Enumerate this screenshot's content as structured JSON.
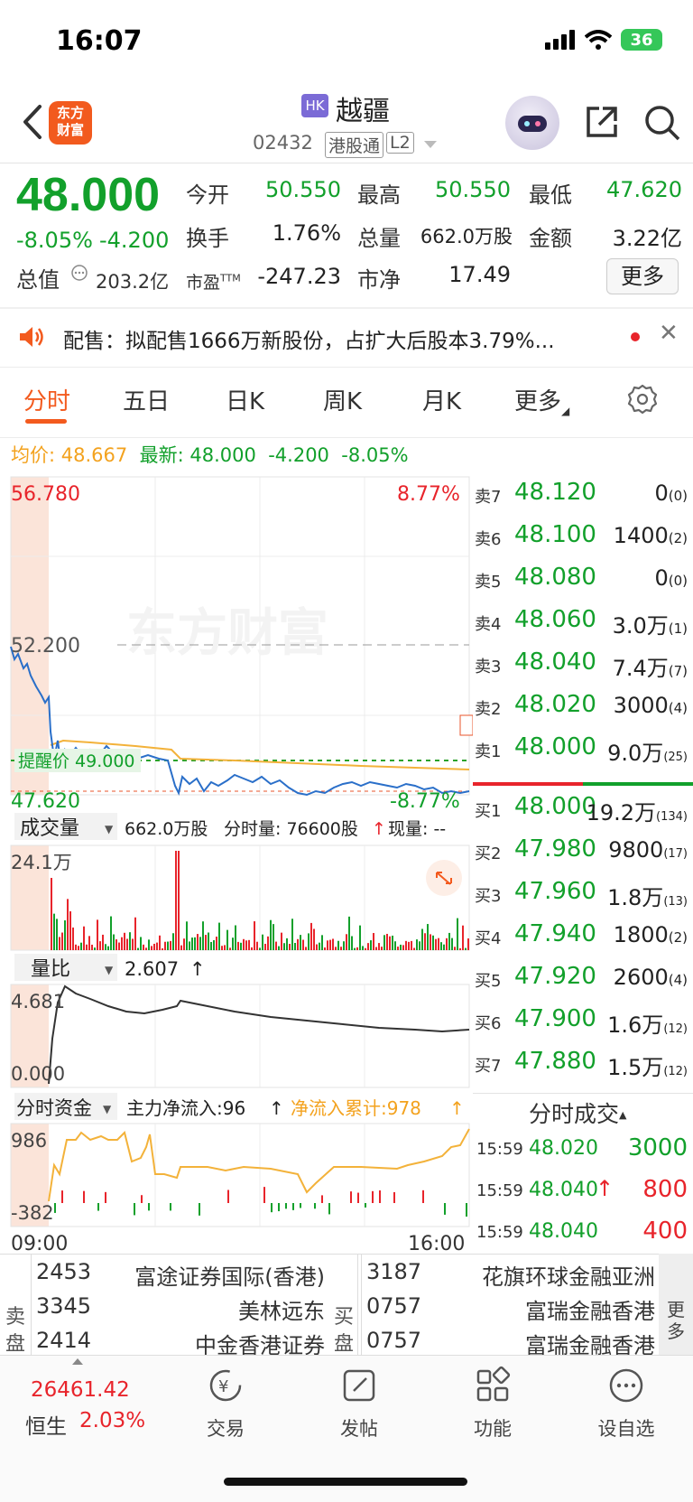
{
  "status": {
    "time": "16:07",
    "battery": "36"
  },
  "header": {
    "logo_text": "东方\n财富",
    "market_badge": "HK",
    "name": "越疆",
    "code": "02432",
    "tags": [
      "港股通",
      "L2"
    ]
  },
  "quote": {
    "price": "48.000",
    "change_pct": "-8.05%",
    "change_amt": "-4.200",
    "fields": [
      {
        "label": "今开",
        "value": "50.550",
        "color": "green"
      },
      {
        "label": "最高",
        "value": "50.550",
        "color": "green"
      },
      {
        "label": "最低",
        "value": "47.620",
        "color": "green"
      },
      {
        "label": "换手",
        "value": "1.76%",
        "color": "black"
      },
      {
        "label": "总量",
        "value": "662.0万股",
        "color": "black"
      },
      {
        "label": "金额",
        "value": "3.22亿",
        "color": "black"
      }
    ],
    "market_cap_label": "总值",
    "market_cap": "203.2亿",
    "pe_label": "市盈",
    "pe_sup": "TTM",
    "pe": "-247.23",
    "pb_label": "市净",
    "pb": "17.49",
    "more_button": "更多"
  },
  "notice": {
    "text": "配售：拟配售1666万新股份，占扩大后股本3.79%..."
  },
  "tabs": [
    "分时",
    "五日",
    "日K",
    "周K",
    "月K",
    "更多"
  ],
  "active_tab": "分时",
  "info_line": {
    "avg_label": "均价:",
    "avg": "48.667",
    "latest_label": "最新:",
    "latest": "48.000",
    "latest_chg": "-4.200",
    "latest_pct": "-8.05%"
  },
  "chart_data": {
    "type": "line",
    "price_axis": {
      "top": "56.780",
      "mid": "52.200",
      "bottom": "47.620",
      "top_pct": "8.77%",
      "bottom_pct": "-8.77%"
    },
    "alert_label": "提醒价 49.000",
    "watermark": "东方财富",
    "volume_panel": {
      "selector": "成交量",
      "total": "662.0万股",
      "tick_label": "分时量: 76600股",
      "now_label": "现量: --",
      "max_label": "24.1万"
    },
    "ratio_panel": {
      "selector": "量比",
      "value": "2.607",
      "max_label": "4.681",
      "min_label": "0.000"
    },
    "flow_panel": {
      "selector": "分时资金",
      "main_flow": "主力净流入:96",
      "cum_flow": "净流入累计:978",
      "max_label": "986",
      "min_label": "-382"
    },
    "time_axis": [
      "09:00",
      "16:00"
    ]
  },
  "order_book": {
    "asks": [
      {
        "label": "卖7",
        "price": "48.120",
        "vol": "0",
        "n": "(0)"
      },
      {
        "label": "卖6",
        "price": "48.100",
        "vol": "1400",
        "n": "(2)"
      },
      {
        "label": "卖5",
        "price": "48.080",
        "vol": "0",
        "n": "(0)"
      },
      {
        "label": "卖4",
        "price": "48.060",
        "vol": "3.0万",
        "n": "(1)"
      },
      {
        "label": "卖3",
        "price": "48.040",
        "vol": "7.4万",
        "n": "(7)"
      },
      {
        "label": "卖2",
        "price": "48.020",
        "vol": "3000",
        "n": "(4)"
      },
      {
        "label": "卖1",
        "price": "48.000",
        "vol": "9.0万",
        "n": "(25)"
      }
    ],
    "bids": [
      {
        "label": "买1",
        "price": "48.000",
        "vol": "19.2万",
        "n": "(134)"
      },
      {
        "label": "买2",
        "price": "47.980",
        "vol": "9800",
        "n": "(17)"
      },
      {
        "label": "买3",
        "price": "47.960",
        "vol": "1.8万",
        "n": "(13)"
      },
      {
        "label": "买4",
        "price": "47.940",
        "vol": "1800",
        "n": "(2)"
      },
      {
        "label": "买5",
        "price": "47.920",
        "vol": "2600",
        "n": "(4)"
      },
      {
        "label": "买6",
        "price": "47.900",
        "vol": "1.6万",
        "n": "(12)"
      },
      {
        "label": "买7",
        "price": "47.880",
        "vol": "1.5万",
        "n": "(12)"
      }
    ]
  },
  "ticks": {
    "title": "分时成交",
    "rows": [
      {
        "time": "15:59",
        "price": "48.020",
        "vol": "3000",
        "dir": ""
      },
      {
        "time": "15:59",
        "price": "48.040",
        "vol": "800",
        "dir": "↑"
      },
      {
        "time": "15:59",
        "price": "48.040",
        "vol": "400",
        "dir": ""
      }
    ]
  },
  "brokers": {
    "sell_label": "卖盘",
    "buy_label": "买盘",
    "sell": [
      {
        "id": "2453",
        "name": "富途证券国际(香港)"
      },
      {
        "id": "3345",
        "name": "美林远东"
      },
      {
        "id": "2414",
        "name": "中金香港证券"
      }
    ],
    "buy": [
      {
        "id": "3187",
        "name": "花旗环球金融亚洲"
      },
      {
        "id": "0757",
        "name": "富瑞金融香港"
      },
      {
        "id": "0757",
        "name": "富瑞金融香港"
      }
    ],
    "more": "更多"
  },
  "bottom_nav": {
    "index_value": "26461.42",
    "index_name": "恒生",
    "index_pct": "2.03%",
    "items": [
      "交易",
      "发帖",
      "功能",
      "设自选"
    ]
  }
}
